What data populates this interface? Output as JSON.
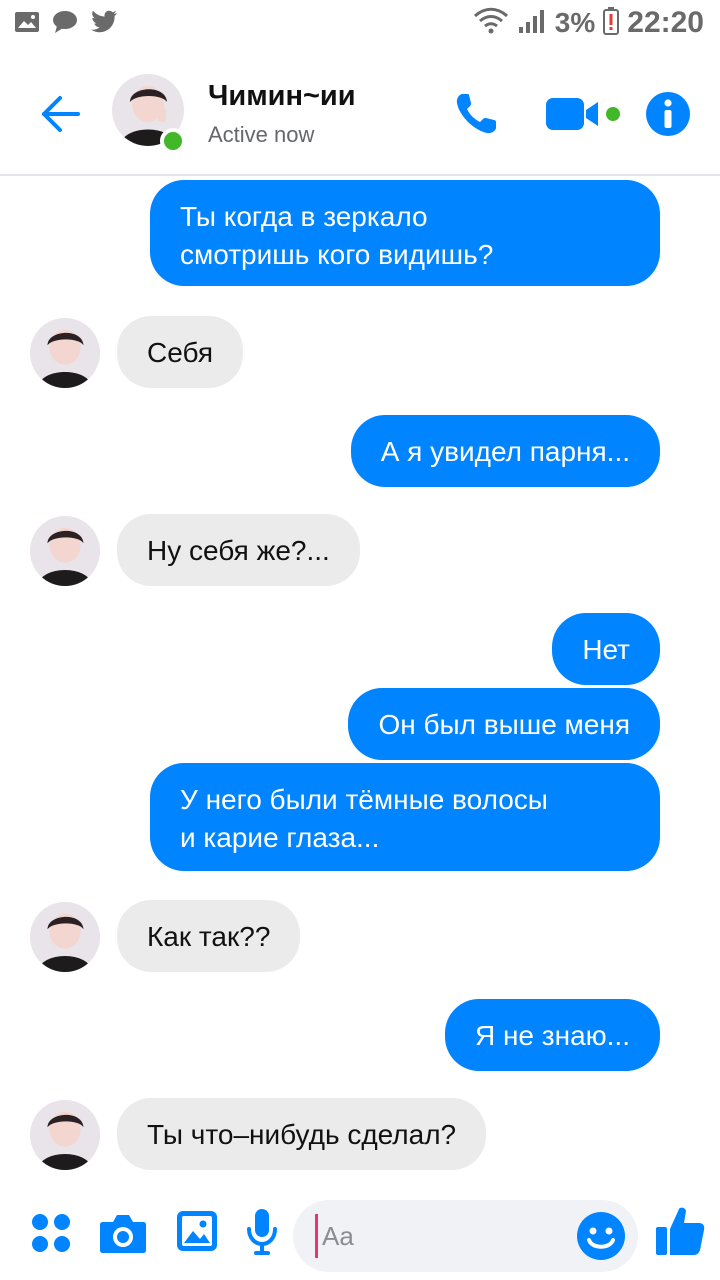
{
  "status_bar": {
    "battery": "3%",
    "time": "22:20"
  },
  "header": {
    "name": "Чимин~ии",
    "status": "Active now"
  },
  "messages": [
    {
      "dir": "out",
      "text": "Ты когда в зеркало\nсмотришь кого видишь?"
    },
    {
      "dir": "in",
      "text": "Себя"
    },
    {
      "dir": "out",
      "text": "А я увидел парня..."
    },
    {
      "dir": "in",
      "text": "Ну себя же?..."
    },
    {
      "dir": "out",
      "text": "Нет"
    },
    {
      "dir": "out",
      "text": "Он был выше меня"
    },
    {
      "dir": "out",
      "text": "У него были тёмные волосы\nи карие глаза..."
    },
    {
      "dir": "in",
      "text": "Как так??"
    },
    {
      "dir": "out",
      "text": "Я не знаю..."
    },
    {
      "dir": "in",
      "text": "Ты что–нибудь сделал?"
    }
  ],
  "composer": {
    "placeholder": "Aa"
  },
  "colors": {
    "accent": "#0084ff",
    "incoming_bubble": "#ebebeb",
    "online": "#42b72a"
  }
}
